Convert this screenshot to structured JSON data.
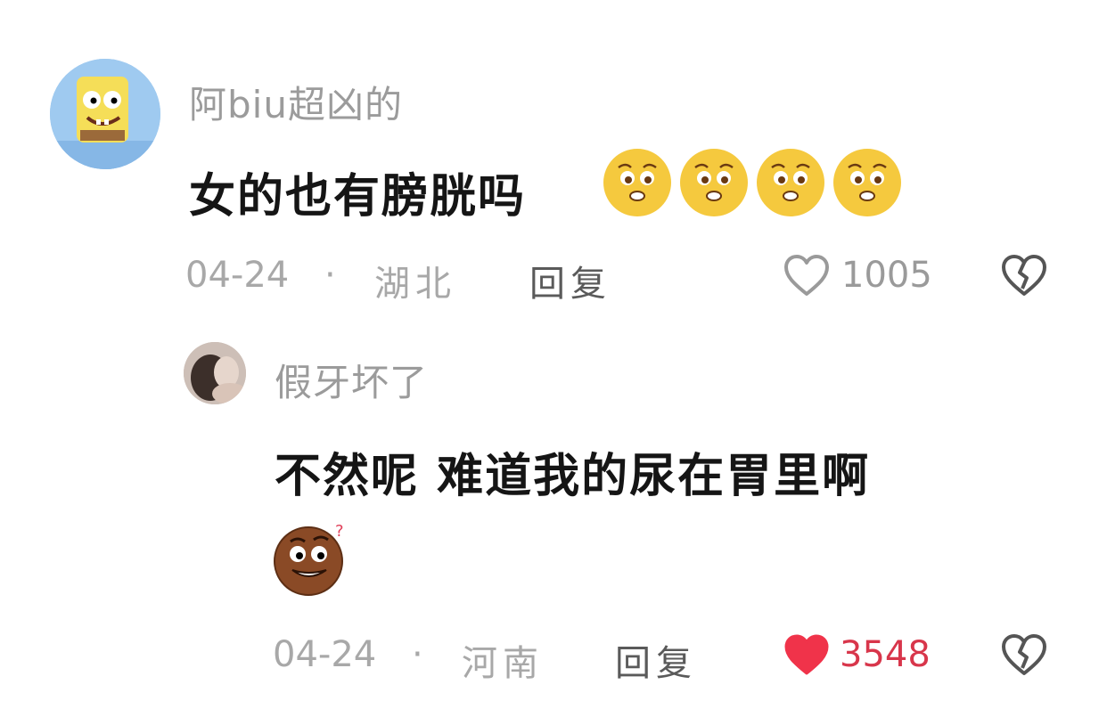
{
  "comments": [
    {
      "username": "阿biu超凶的",
      "text": "女的也有膀胱吗",
      "emoji_names": [
        "pleading-face-icon",
        "pleading-face-icon",
        "pleading-face-icon",
        "pleading-face-icon"
      ],
      "date": "04-24",
      "separator": "·",
      "location": "湖北",
      "reply_label": "回复",
      "likes": "1005",
      "liked": false
    },
    {
      "username": "假牙坏了",
      "text": "不然呢 难道我的尿在胃里啊",
      "emoji_names": [
        "confused-grin-icon"
      ],
      "date": "04-24",
      "separator": "·",
      "location": "河南",
      "reply_label": "回复",
      "likes": "3548",
      "liked": true
    }
  ],
  "colors": {
    "meta_text": "#a8a8a8",
    "reply_action": "#5a5a5a",
    "liked_heart": "#f0334a",
    "like_count_active": "#d8364b"
  }
}
